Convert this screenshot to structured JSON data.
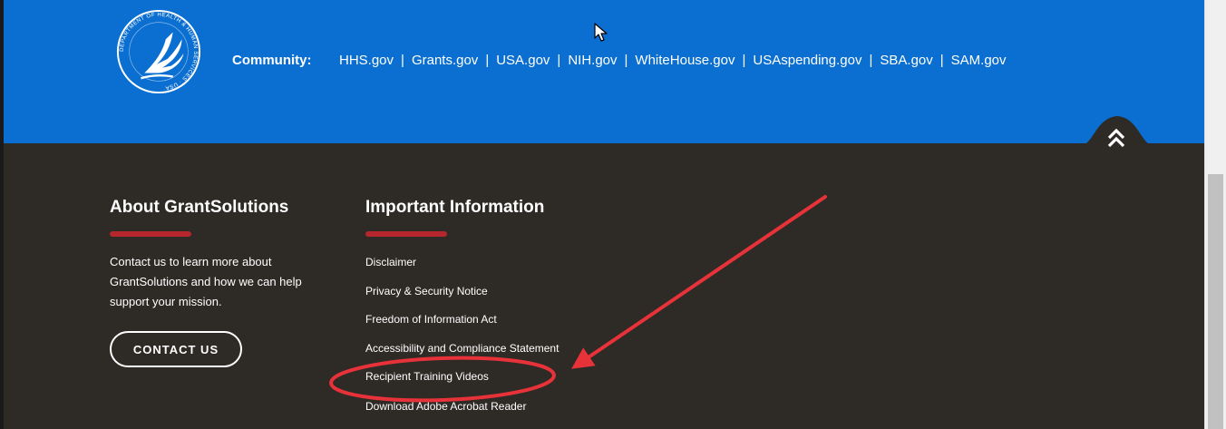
{
  "community": {
    "label": "Community:",
    "links": [
      "HHS.gov",
      "Grants.gov",
      "USA.gov",
      "NIH.gov",
      "WhiteHouse.gov",
      "USAspending.gov",
      "SBA.gov",
      "SAM.gov"
    ],
    "separator": "|"
  },
  "seal": {
    "icon": "hhs-seal-icon",
    "text": "DEPARTMENT OF HEALTH & HUMAN SERVICES · USA"
  },
  "back_to_top": {
    "icon": "double-chevron-up-icon"
  },
  "about": {
    "heading": "About GrantSolutions",
    "text": "Contact us to learn more about GrantSolutions and how we can help support your mission.",
    "button_label": "CONTACT US"
  },
  "important": {
    "heading": "Important Information",
    "items": [
      "Disclaimer",
      "Privacy & Security Notice",
      "Freedom of Information Act",
      "Accessibility and Compliance Statement",
      "Recipient Training Videos"
    ],
    "clipped_item": "Download Adobe Acrobat Reader"
  },
  "colors": {
    "community_bar": "#0a6fd1",
    "footer": "#2e2a26",
    "accent_underline": "#b5262d",
    "annotation": "#e8323a"
  }
}
